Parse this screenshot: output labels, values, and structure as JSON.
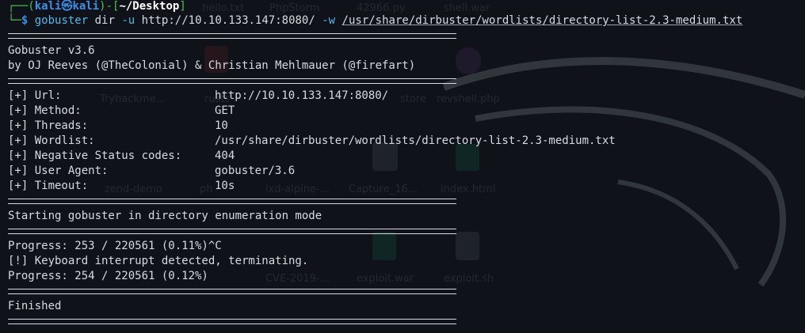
{
  "prompt": {
    "corner_top": "┌──(",
    "user": "kali",
    "at_symbol": "㉿",
    "host": "kali",
    "mid": ")-[",
    "path": "~/Desktop",
    "end": "]",
    "corner_bottom": "└─",
    "dollar": "$"
  },
  "command": {
    "program": "gobuster",
    "subcommand": "dir",
    "url_flag": "-u",
    "url": "http://10.10.133.147:8080/",
    "wordlist_flag": "-w",
    "wordlist": "/usr/share/dirbuster/wordlists/directory-list-2.3-medium.txt"
  },
  "banner": {
    "version": "Gobuster v3.6",
    "authors": "by OJ Reeves (@TheColonial) & Christian Mehlmauer (@firefart)"
  },
  "config": [
    {
      "key": "[+] Url:",
      "value": "http://10.10.133.147:8080/"
    },
    {
      "key": "[+] Method:",
      "value": "GET"
    },
    {
      "key": "[+] Threads:",
      "value": "10"
    },
    {
      "key": "[+] Wordlist:",
      "value": "/usr/share/dirbuster/wordlists/directory-list-2.3-medium.txt"
    },
    {
      "key": "[+] Negative Status codes:",
      "value": "404"
    },
    {
      "key": "[+] User Agent:",
      "value": "gobuster/3.6"
    },
    {
      "key": "[+] Timeout:",
      "value": "10s"
    }
  ],
  "status": {
    "starting": "Starting gobuster in directory enumeration mode",
    "progress_1": "Progress: 253 / 220561 (0.11%)^C",
    "interrupt": "[!] Keyboard interrupt detected, terminating.",
    "progress_2": "Progress: 254 / 220561 (0.12%)",
    "finished": "Finished"
  },
  "desktop_icons": [
    "hello.txt",
    "PhpStorm",
    "42966.py",
    "shell.war",
    "Tryhackme...",
    "rusts",
    "store",
    "revshell.php",
    "zend-demo",
    "ph",
    "lxd-alpine-...",
    "Capture_16...",
    "index.html",
    "CVE-2019-...",
    "exploit.war",
    "exploit.sh"
  ]
}
